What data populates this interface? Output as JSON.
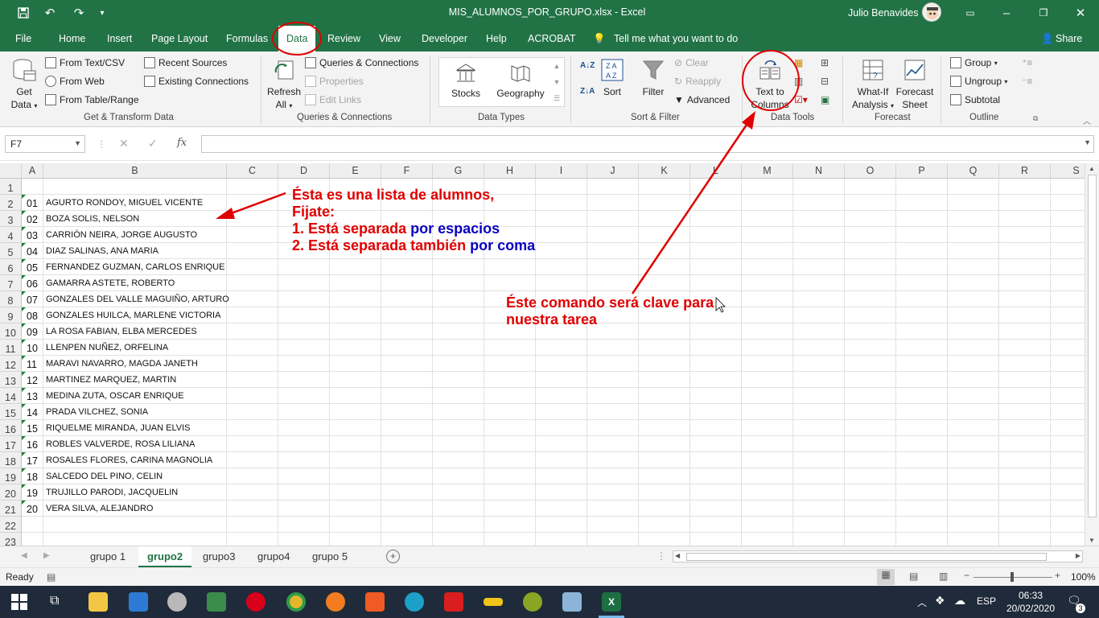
{
  "window": {
    "title": "MIS_ALUMNOS_POR_GRUPO.xlsx  -  Excel",
    "user": "Julio Benavides"
  },
  "tabs": [
    "File",
    "Home",
    "Insert",
    "Page Layout",
    "Formulas",
    "Data",
    "Review",
    "View",
    "Developer",
    "Help",
    "ACROBAT"
  ],
  "tell_me": "Tell me what you want to do",
  "share": "Share",
  "ribbon": {
    "get_data": {
      "l1": "Get",
      "l2": "Data"
    },
    "from_text": "From Text/CSV",
    "from_web": "From Web",
    "from_table": "From Table/Range",
    "recent_sources": "Recent Sources",
    "existing_conn": "Existing Connections",
    "group1": "Get & Transform Data",
    "refresh": {
      "l1": "Refresh",
      "l2": "All"
    },
    "queries": "Queries & Connections",
    "properties": "Properties",
    "edit_links": "Edit Links",
    "group2": "Queries & Connections",
    "stocks": "Stocks",
    "geography": "Geography",
    "group3": "Data Types",
    "sort": "Sort",
    "filter": "Filter",
    "clear": "Clear",
    "reapply": "Reapply",
    "advanced": "Advanced",
    "group4": "Sort & Filter",
    "ttc": {
      "l1": "Text to",
      "l2": "Columns"
    },
    "group5": "Data Tools",
    "whatif": {
      "l1": "What-If",
      "l2": "Analysis"
    },
    "forecast": {
      "l1": "Forecast",
      "l2": "Sheet"
    },
    "group6": "Forecast",
    "grp": "Group",
    "ungrp": "Ungroup",
    "subtotal": "Subtotal",
    "group7": "Outline"
  },
  "namebox": "F7",
  "fx": "fx",
  "columns": [
    "A",
    "B",
    "C",
    "D",
    "E",
    "F",
    "G",
    "H",
    "I",
    "J",
    "K",
    "L",
    "M",
    "N",
    "O",
    "P",
    "Q",
    "R",
    "S"
  ],
  "rows": [
    "1",
    "2",
    "3",
    "4",
    "5",
    "6",
    "7",
    "8",
    "9",
    "10",
    "11",
    "12",
    "13",
    "14",
    "15",
    "16",
    "17",
    "18",
    "19",
    "20",
    "21",
    "22",
    "23"
  ],
  "students": [
    {
      "n": "01",
      "name": "AGURTO RONDOY, MIGUEL VICENTE"
    },
    {
      "n": "02",
      "name": "BOZA SOLIS, NELSON"
    },
    {
      "n": "03",
      "name": "CARRIÓN NEIRA, JORGE AUGUSTO"
    },
    {
      "n": "04",
      "name": "DIAZ SALINAS, ANA MARIA"
    },
    {
      "n": "05",
      "name": "FERNANDEZ GUZMAN, CARLOS ENRIQUE"
    },
    {
      "n": "06",
      "name": "GAMARRA ASTETE, ROBERTO"
    },
    {
      "n": "07",
      "name": "GONZALES DEL VALLE MAGUIÑO, ARTURO"
    },
    {
      "n": "08",
      "name": "GONZALES HUILCA, MARLENE VICTORIA"
    },
    {
      "n": "09",
      "name": "LA ROSA FABIAN, ELBA MERCEDES"
    },
    {
      "n": "10",
      "name": "LLENPEN NUÑEZ, ORFELINA"
    },
    {
      "n": "11",
      "name": "MARAVI NAVARRO, MAGDA JANETH"
    },
    {
      "n": "12",
      "name": "MARTINEZ MARQUEZ, MARTIN"
    },
    {
      "n": "13",
      "name": "MEDINA ZUTA, OSCAR ENRIQUE"
    },
    {
      "n": "14",
      "name": "PRADA VILCHEZ, SONIA"
    },
    {
      "n": "15",
      "name": "RIQUELME MIRANDA, JUAN ELVIS"
    },
    {
      "n": "16",
      "name": "ROBLES VALVERDE, ROSA LILIANA"
    },
    {
      "n": "17",
      "name": "ROSALES FLORES, CARINA MAGNOLIA"
    },
    {
      "n": "18",
      "name": "SALCEDO DEL PINO, CELIN"
    },
    {
      "n": "19",
      "name": "TRUJILLO PARODI, JACQUELIN"
    },
    {
      "n": "20",
      "name": "VERA SILVA, ALEJANDRO"
    }
  ],
  "annotation1": {
    "l1": "Ésta es una lista de alumnos,",
    "l2": "Fijate:",
    "l3a": "1. Está separada ",
    "l3b": "por espacios",
    "l4a": "2. Está separada también ",
    "l4b": "por coma"
  },
  "annotation2": {
    "l1": "Éste comando será clave para",
    "l2": "nuestra tarea"
  },
  "sheets": [
    "grupo 1",
    "grupo2",
    "grupo3",
    "grupo4",
    "grupo 5"
  ],
  "status": {
    "ready": "Ready",
    "zoom": "100%"
  },
  "taskbar": {
    "lang": "ESP",
    "time": "06:33",
    "date": "20/02/2020",
    "notif": "3"
  },
  "colors": {
    "excel_green": "#217346",
    "annotation_red": "#e00000",
    "annotation_blue": "#0a00c0"
  }
}
